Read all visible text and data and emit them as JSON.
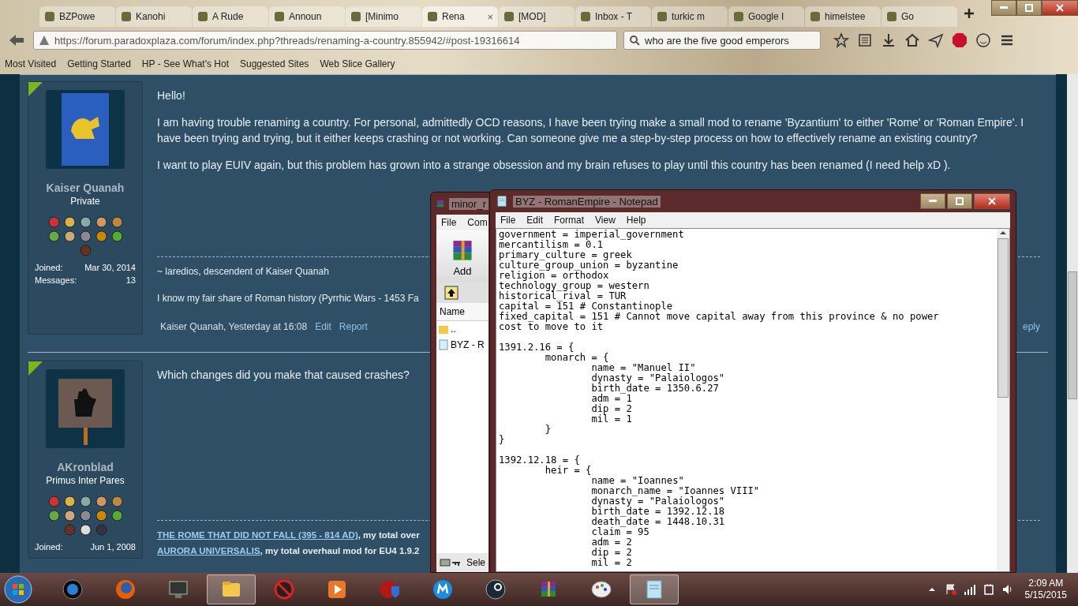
{
  "browser": {
    "tabs": [
      {
        "label": "BZPowe",
        "selected": false
      },
      {
        "label": "Kanohi",
        "selected": false
      },
      {
        "label": "A Rude",
        "selected": false
      },
      {
        "label": "Announ",
        "selected": false
      },
      {
        "label": "[Minimo",
        "selected": false
      },
      {
        "label": "Rena",
        "selected": true,
        "close": "×"
      },
      {
        "label": "[MOD]",
        "selected": false
      },
      {
        "label": "Inbox - T",
        "selected": false
      },
      {
        "label": "turkic m",
        "selected": false
      },
      {
        "label": "Google I",
        "selected": false
      },
      {
        "label": "himelstee",
        "selected": false
      },
      {
        "label": "Go",
        "selected": false
      }
    ],
    "address": "https://forum.paradoxplaza.com/forum/index.php?threads/renaming-a-country.855942/#post-19316614",
    "search": "who are the five good emperors",
    "bookmarks": [
      "Most Visited",
      "Getting Started",
      "HP - See What's Hot",
      "Suggested Sites",
      "Web Slice Gallery"
    ]
  },
  "posts": [
    {
      "author": "Kaiser Quanah",
      "user_title": "Private",
      "joined_label": "Joined:",
      "joined": "Mar 30, 2014",
      "messages_label": "Messages:",
      "messages": "13",
      "body": [
        "Hello!",
        "I am having trouble renaming a country. For personal, admittedly OCD reasons, I have been trying make a small mod to rename 'Byzantium' to either 'Rome' or 'Roman Empire'. I have been trying and trying, but it either keeps crashing or not working. Can someone give me a step-by-step process on how to effectively rename an existing country?",
        "I want to play EUIV again, but this problem has grown into a strange obsession and my brain refuses to play until this country has been renamed (I need help xD )."
      ],
      "signature": [
        {
          "text": "~ laredios, descendent of Kaiser Quanah"
        },
        {
          "text": "I know my fair share of Roman history (Pyrrhic Wars - 1453 Fa"
        }
      ],
      "footer": {
        "byline": "Kaiser Quanah, Yesterday at 16:08",
        "links": [
          "Edit",
          "Report"
        ],
        "reply": "eply"
      }
    },
    {
      "author": "AKronblad",
      "user_title": "Primus Inter Pares",
      "joined_label": "Joined:",
      "joined": "Jun 1, 2008",
      "body": [
        "Which changes did you make that caused crashes?"
      ],
      "signature": [
        {
          "link": "THE ROME THAT DID NOT FALL (395 - 814 AD)",
          "text": ", my total over"
        },
        {
          "link": "AURORA UNIVERSALIS",
          "text": ", my total overhaul mod for EU4 1.9.2"
        }
      ]
    }
  ],
  "winrar": {
    "title": "minor_r",
    "menu": [
      "File",
      "Com"
    ],
    "tool": "Add",
    "column": "Name",
    "files": [
      {
        "kind": "folder",
        "name": ".."
      },
      {
        "kind": "file",
        "name": "BYZ - R"
      }
    ],
    "status": "Sele"
  },
  "notepad": {
    "title": "BYZ - RomanEmpire - Notepad",
    "menu": [
      "File",
      "Edit",
      "Format",
      "View",
      "Help"
    ],
    "blocks": [
      [
        "government = imperial_government",
        "mercantilism = 0.1",
        "primary_culture = greek",
        "culture_group_union = byzantine",
        "religion = orthodox",
        "technology_group = western",
        "historical_rival = TUR",
        "capital = 151 # Constantinople",
        "fixed_capital = 151 # Cannot move capital away from this province & no power",
        "cost to move to it"
      ],
      [
        "1391.2.16 = {",
        "\tmonarch = {",
        "\t\tname = \"Manuel II\"",
        "\t\tdynasty = \"Palaiologos\"",
        "\t\tbirth_date = 1350.6.27",
        "\t\tadm = 1",
        "\t\tdip = 2",
        "\t\tmil = 1",
        "\t}",
        "}"
      ],
      [
        "1392.12.18 = {",
        "\their = {",
        "\t\tname = \"Ioannes\"",
        "\t\tmonarch_name = \"Ioannes VIII\"",
        "\t\tdynasty = \"Palaiologos\"",
        "\t\tbirth_date = 1392.12.18",
        "\t\tdeath_date = 1448.10.31",
        "\t\tclaim = 95",
        "\t\tadm = 2",
        "\t\tdip = 2",
        "\t\tmil = 2"
      ]
    ]
  },
  "taskbar": {
    "apps": [
      {
        "kind": "hp",
        "selected": false
      },
      {
        "kind": "firefox",
        "selected": false
      },
      {
        "kind": "monitor",
        "selected": false
      },
      {
        "kind": "explorer",
        "selected": true
      },
      {
        "kind": "blocked",
        "selected": false
      },
      {
        "kind": "player",
        "selected": false
      },
      {
        "kind": "shield",
        "selected": false
      },
      {
        "kind": "m",
        "selected": false
      },
      {
        "kind": "steam",
        "selected": false
      },
      {
        "kind": "archive",
        "selected": false
      },
      {
        "kind": "paint",
        "selected": false
      },
      {
        "kind": "notepad",
        "selected": true
      }
    ],
    "time": "2:09 AM",
    "date": "5/15/2015"
  }
}
